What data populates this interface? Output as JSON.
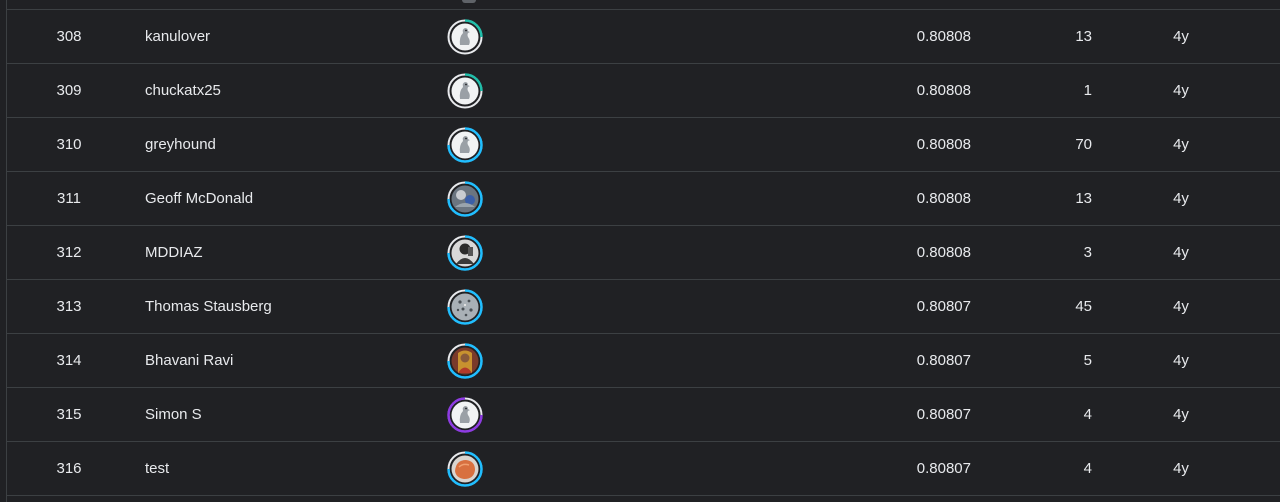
{
  "leaderboard": {
    "rows": [
      {
        "rank": "308",
        "name": "kanulover",
        "score": "0.80808",
        "entries": "13",
        "last": "4y",
        "avatar": "default-goose-avatar",
        "tier_color": "#20BEFF"
      },
      {
        "rank": "309",
        "name": "chuckatx25",
        "score": "0.80808",
        "entries": "1",
        "last": "4y",
        "avatar": "default-goose-avatar",
        "tier_color": "#20BEFF"
      },
      {
        "rank": "310",
        "name": "greyhound",
        "score": "0.80808",
        "entries": "70",
        "last": "4y",
        "avatar": "default-goose-avatar",
        "tier_color": "#20BEFF"
      },
      {
        "rank": "311",
        "name": "Geoff McDonald",
        "score": "0.80808",
        "entries": "13",
        "last": "4y",
        "avatar": "photo-avatar",
        "tier_color": "#20BEFF"
      },
      {
        "rank": "312",
        "name": "MDDIAZ",
        "score": "0.80808",
        "entries": "3",
        "last": "4y",
        "avatar": "photo-avatar",
        "tier_color": "#20BEFF"
      },
      {
        "rank": "313",
        "name": "Thomas Stausberg",
        "score": "0.80807",
        "entries": "45",
        "last": "4y",
        "avatar": "leopard-photo-avatar",
        "tier_color": "#20BEFF"
      },
      {
        "rank": "314",
        "name": "Bhavani Ravi",
        "score": "0.80807",
        "entries": "5",
        "last": "4y",
        "avatar": "photo-avatar",
        "tier_color": "#20BEFF"
      },
      {
        "rank": "315",
        "name": "Simon S",
        "score": "0.80807",
        "entries": "4",
        "last": "4y",
        "avatar": "default-goose-avatar",
        "tier_color": "#8E3BE3"
      },
      {
        "rank": "316",
        "name": "test",
        "score": "0.80807",
        "entries": "4",
        "last": "4y",
        "avatar": "orange-avatar",
        "tier_color": "#20BEFF"
      }
    ]
  },
  "colors": {
    "background": "#202124",
    "divider": "#3C4043",
    "text": "#E8EAED",
    "novice_tier": "#20BEAA",
    "contributor_tier": "#20BEFF",
    "expert_tier": "#8E3BE3"
  }
}
